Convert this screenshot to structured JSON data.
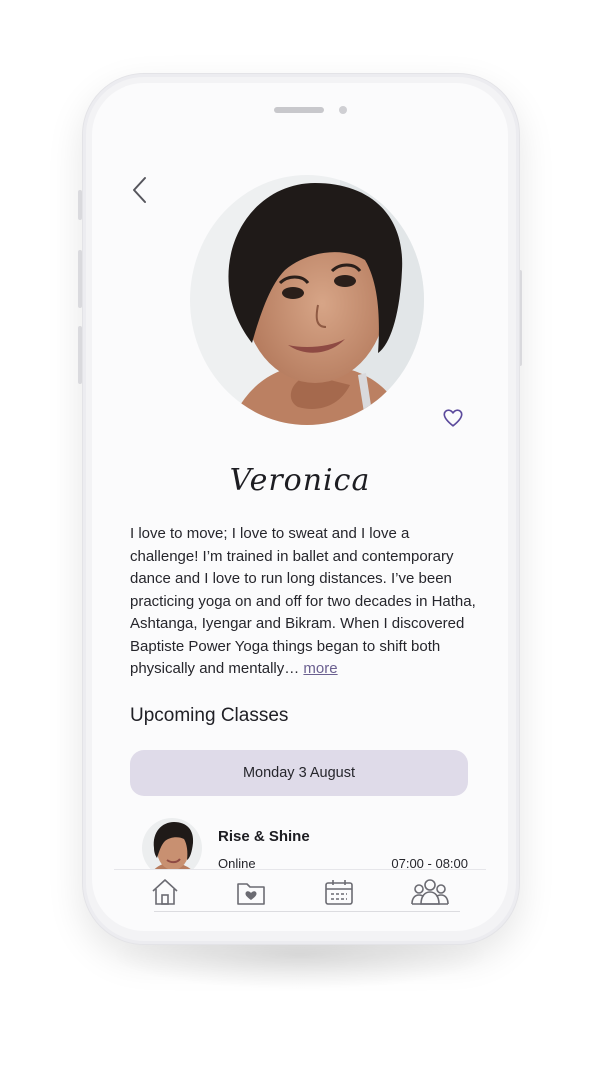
{
  "profile": {
    "name": "Veronica",
    "bio": "I love to move; I love to sweat and I love a challenge! I’m trained in ballet and contemporary dance and I love to run long distances. I’ve been practicing yoga on and off for two decades in Hatha, Ashtanga, Iyengar and Bikram. When I discovered Baptiste Power Yoga things began to shift both physically and mentally…",
    "more_label": "more"
  },
  "upcoming": {
    "title": "Upcoming Classes",
    "date_label": "Monday 3 August",
    "classes": [
      {
        "title": "Rise & Shine",
        "mode": "Online",
        "time": "07:00 - 08:00"
      }
    ]
  },
  "icons": {
    "back": "chevron-left-icon",
    "favorite": "heart-outline-icon",
    "tabs": [
      "home-icon",
      "favorites-folder-icon",
      "calendar-icon",
      "community-icon"
    ]
  },
  "colors": {
    "accent": "#5b4a9c",
    "pill": "#dfdbe9",
    "link": "#6b6090"
  }
}
